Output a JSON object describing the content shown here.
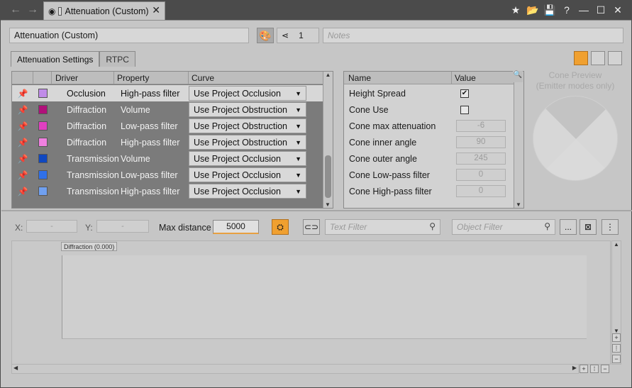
{
  "window": {
    "tab_title": "Attenuation (Custom)",
    "tab_close": "✕",
    "nav_back": "←",
    "nav_forward": "→",
    "toolbar_icons": [
      "★",
      "📂",
      "💾",
      "?",
      "—",
      "☐",
      "✕"
    ]
  },
  "header": {
    "name_value": "Attenuation (Custom)",
    "reference_count": "1",
    "notes_placeholder": "Notes"
  },
  "tabs": [
    {
      "label": "Attenuation Settings",
      "active": true
    },
    {
      "label": "RTPC",
      "active": false
    }
  ],
  "curve_grid": {
    "columns": [
      "Driver",
      "Property",
      "Curve"
    ],
    "rows": [
      {
        "driver": "Occlusion",
        "property": "High-pass filter",
        "curve": "Use Project Occlusion",
        "color": "#c08ce8"
      },
      {
        "driver": "Diffraction",
        "property": "Volume",
        "curve": "Use Project Obstruction",
        "color": "#b0107a"
      },
      {
        "driver": "Diffraction",
        "property": "Low-pass filter",
        "curve": "Use Project Obstruction",
        "color": "#e040c0"
      },
      {
        "driver": "Diffraction",
        "property": "High-pass filter",
        "curve": "Use Project Obstruction",
        "color": "#f080e0"
      },
      {
        "driver": "Transmission",
        "property": "Volume",
        "curve": "Use Project Occlusion",
        "color": "#1048c0"
      },
      {
        "driver": "Transmission",
        "property": "Low-pass filter",
        "curve": "Use Project Occlusion",
        "color": "#3070e8"
      },
      {
        "driver": "Transmission",
        "property": "High-pass filter",
        "curve": "Use Project Occlusion",
        "color": "#70a0f0"
      }
    ]
  },
  "properties": {
    "columns": [
      "Name",
      "Value"
    ],
    "rows": [
      {
        "name": "Height Spread",
        "type": "check",
        "value": "✔"
      },
      {
        "name": "Cone Use",
        "type": "check",
        "value": ""
      },
      {
        "name": "Cone max attenuation",
        "type": "num",
        "value": "-6"
      },
      {
        "name": "Cone inner angle",
        "type": "num",
        "value": "90"
      },
      {
        "name": "Cone outer angle",
        "type": "num",
        "value": "245"
      },
      {
        "name": "Cone Low-pass filter",
        "type": "num",
        "value": "0"
      },
      {
        "name": "Cone High-pass filter",
        "type": "num",
        "value": "0"
      }
    ]
  },
  "cone_preview": {
    "title": "Cone Preview",
    "subtitle": "(Emitter modes only)"
  },
  "graph_toolbar": {
    "x_label": "X:",
    "x_value": "-",
    "y_label": "Y:",
    "y_value": "-",
    "max_distance_label": "Max distance",
    "max_distance_value": "5000",
    "text_filter_placeholder": "Text Filter",
    "object_filter_placeholder": "Object Filter",
    "more_label": "...",
    "menu_label": "⋮"
  },
  "graph": {
    "legend_label": "Diffraction (0.000)"
  }
}
